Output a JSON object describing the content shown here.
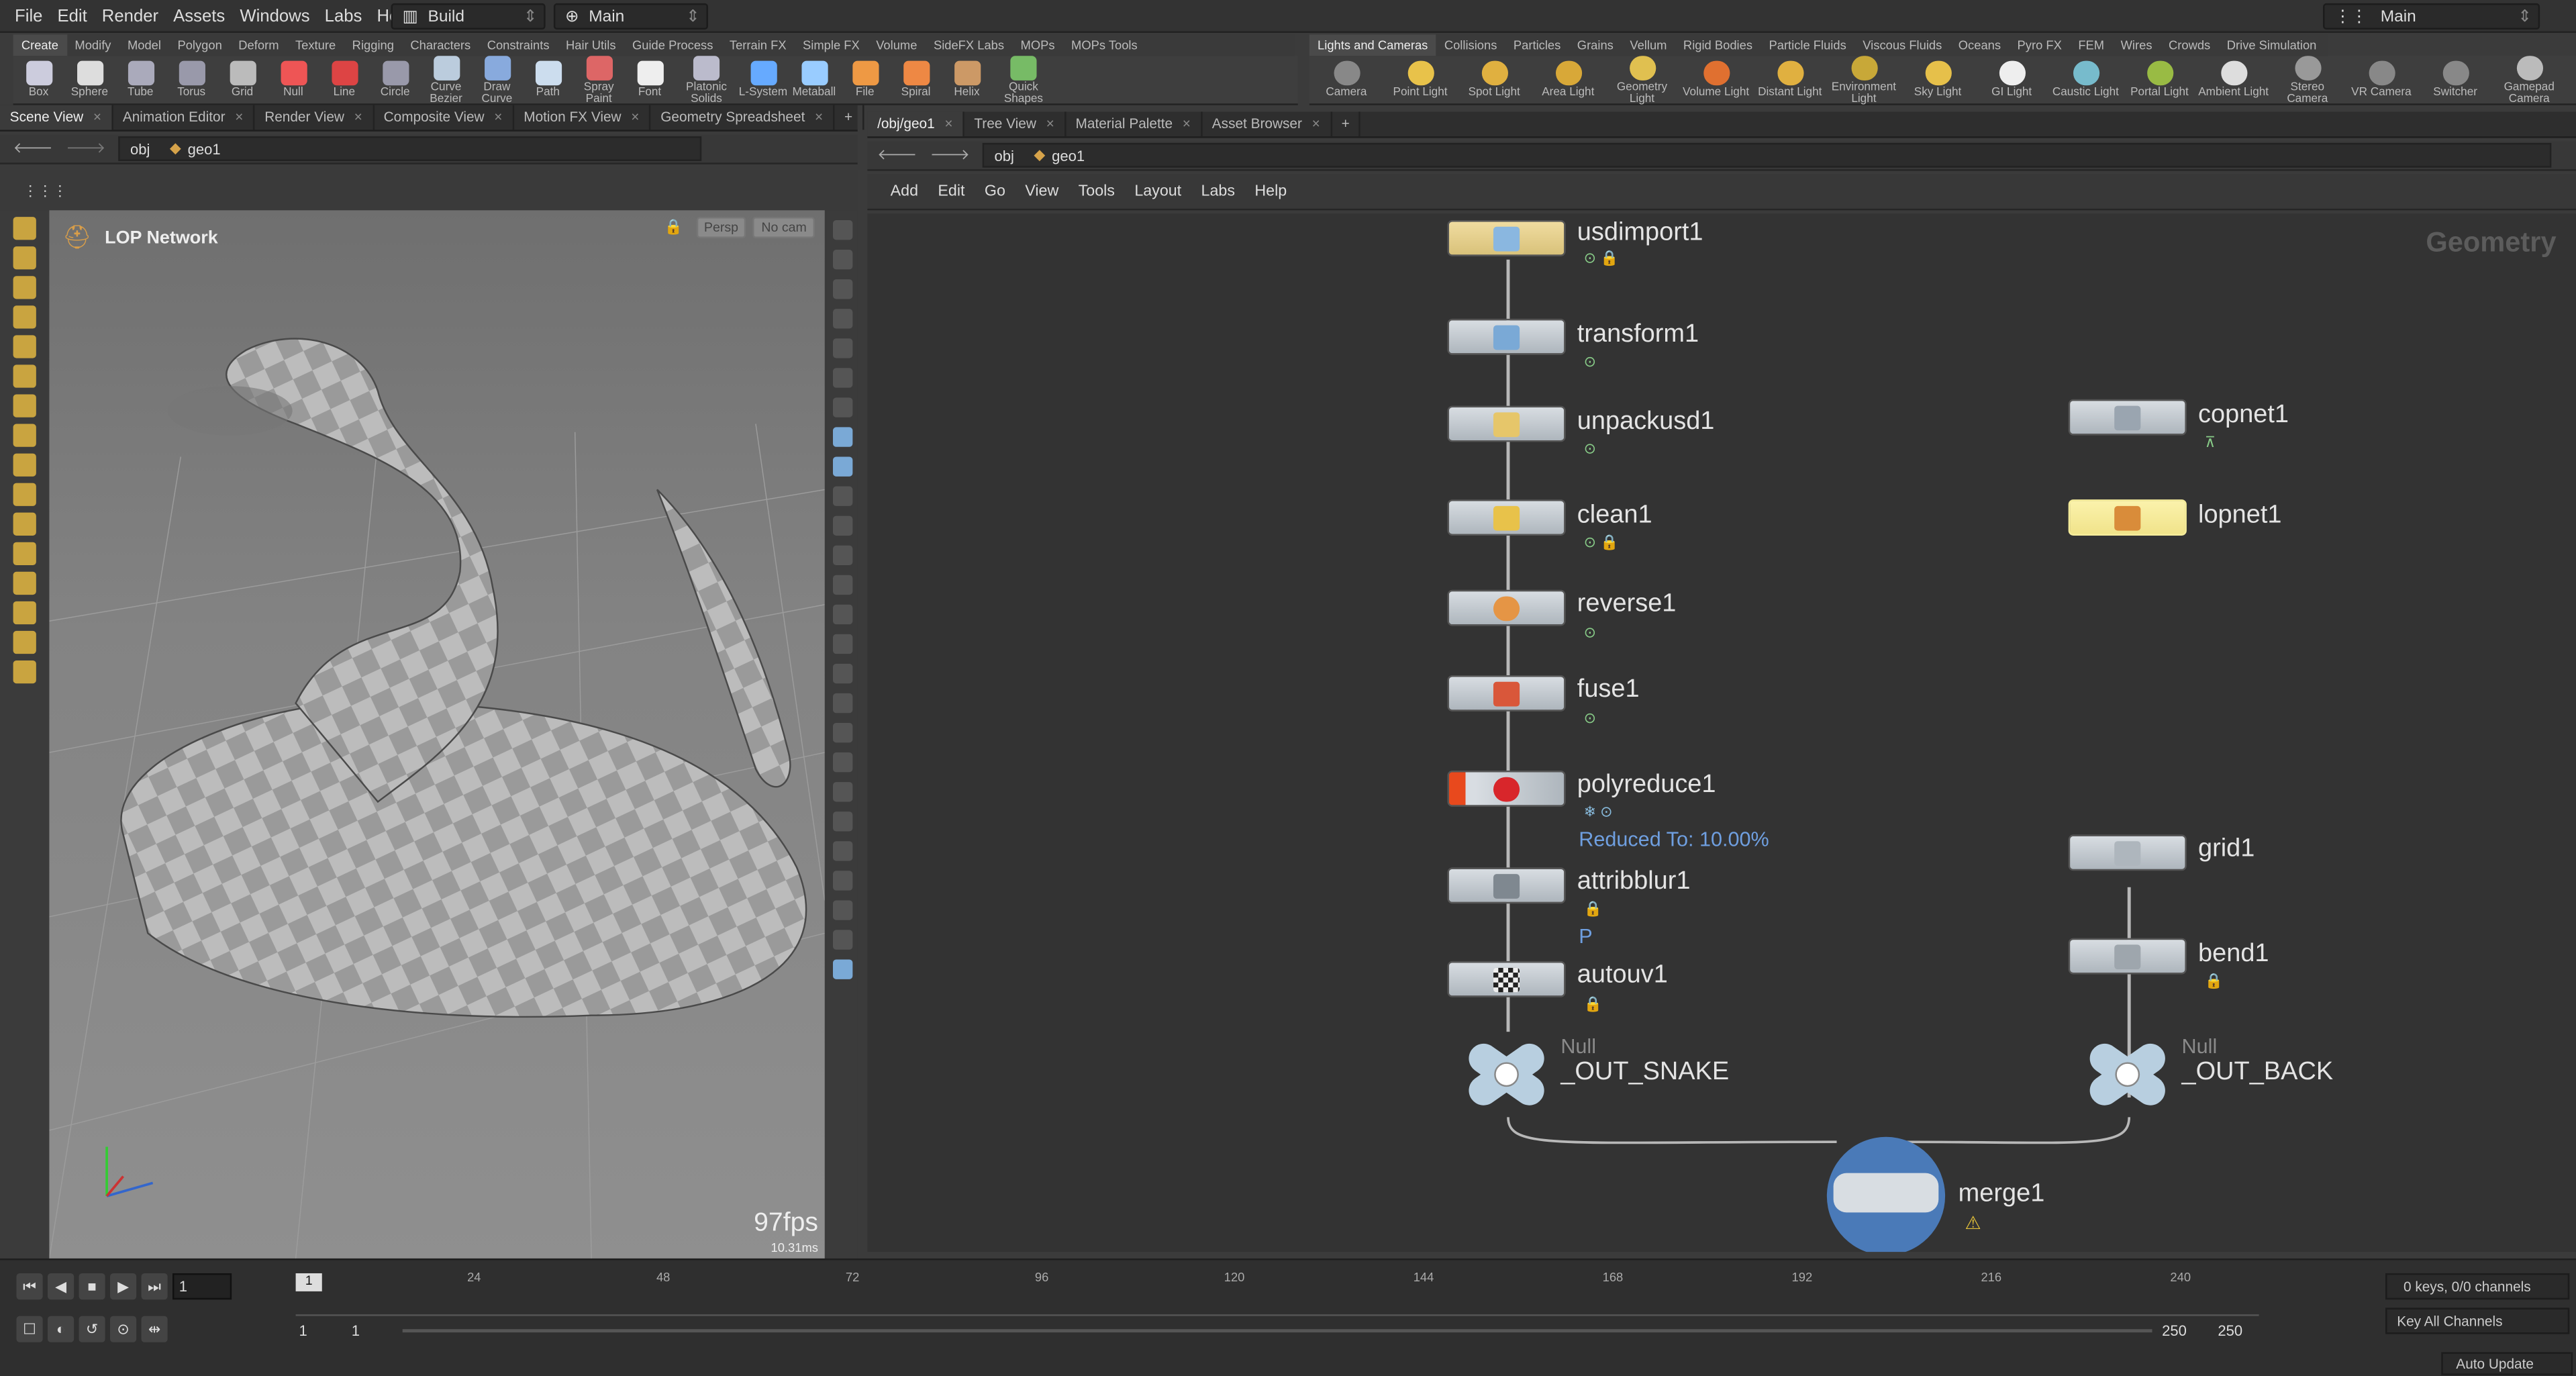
{
  "menu": [
    "File",
    "Edit",
    "Render",
    "Assets",
    "Windows",
    "Labs",
    "Help"
  ],
  "desktop": "Build",
  "context": "Main",
  "desktop_right": "Main",
  "shelf_tabs_left": [
    "Create",
    "Modify",
    "Model",
    "Polygon",
    "Deform",
    "Texture",
    "Rigging",
    "Characters",
    "Constraints",
    "Hair Utils",
    "Guide Process",
    "Terrain FX",
    "Simple FX",
    "Volume",
    "SideFX Labs",
    "MOPs",
    "MOPs Tools"
  ],
  "shelf_tabs_right": [
    "Lights and Cameras",
    "Collisions",
    "Particles",
    "Grains",
    "Vellum",
    "Rigid Bodies",
    "Particle Fluids",
    "Viscous Fluids",
    "Oceans",
    "Pyro FX",
    "FEM",
    "Wires",
    "Crowds",
    "Drive Simulation"
  ],
  "tools_left": [
    "Box",
    "Sphere",
    "Tube",
    "Torus",
    "Grid",
    "Null",
    "Line",
    "Circle",
    "Curve Bezier",
    "Draw Curve",
    "Path",
    "Spray Paint",
    "Font",
    "Platonic Solids",
    "L-System",
    "Metaball",
    "File",
    "Spiral",
    "Helix",
    "Quick Shapes"
  ],
  "tools_right": [
    "Camera",
    "Point Light",
    "Spot Light",
    "Area Light",
    "Geometry Light",
    "Volume Light",
    "Distant Light",
    "Environment Light",
    "Sky Light",
    "GI Light",
    "Caustic Light",
    "Portal Light",
    "Ambient Light",
    "Stereo Camera",
    "VR Camera",
    "Switcher",
    "Gamepad Camera"
  ],
  "left_tabs": [
    "Scene View",
    "Animation Editor",
    "Render View",
    "Composite View",
    "Motion FX View",
    "Geometry Spreadsheet"
  ],
  "right_tabs": [
    "/obj/geo1",
    "Tree View",
    "Material Palette",
    "Asset Browser"
  ],
  "path": {
    "obj": "obj",
    "geo": "geo1"
  },
  "net_menu": [
    "Add",
    "Edit",
    "Go",
    "View",
    "Tools",
    "Layout",
    "Labs",
    "Help"
  ],
  "viewport": {
    "title": "LOP Network",
    "persp": "Persp",
    "cam": "No cam",
    "fps": "97fps",
    "ms": "10.31ms"
  },
  "network": {
    "context_label": "Geometry",
    "nodes": {
      "usdimport": "usdimport1",
      "transform": "transform1",
      "unpackusd": "unpackusd1",
      "clean": "clean1",
      "reverse": "reverse1",
      "fuse": "fuse1",
      "polyreduce": "polyreduce1",
      "attribblur": "attribblur1",
      "autouv": "autouv1",
      "out_snake": "_OUT_SNAKE",
      "copnet": "copnet1",
      "lopnet": "lopnet1",
      "grid": "grid1",
      "bend": "bend1",
      "out_back": "_OUT_BACK",
      "merge": "merge1"
    },
    "null_label": "Null",
    "reduced": "Reduced To: 10.00%",
    "blur_attr": "P"
  },
  "timeline": {
    "frame": "1",
    "ticks": [
      "24",
      "48",
      "72",
      "96",
      "120",
      "144",
      "168",
      "192",
      "216",
      "240"
    ],
    "start": "1",
    "start2": "1",
    "end": "250",
    "end2": "250",
    "keys": "0 keys, 0/0 channels",
    "keyall": "Key All Channels",
    "auto": "Auto Update",
    "marker": "1"
  },
  "colors": {
    "selected_node": "#f5ec9a",
    "polyreduce": "#e8491d",
    "accent": "#5a8bd6"
  }
}
